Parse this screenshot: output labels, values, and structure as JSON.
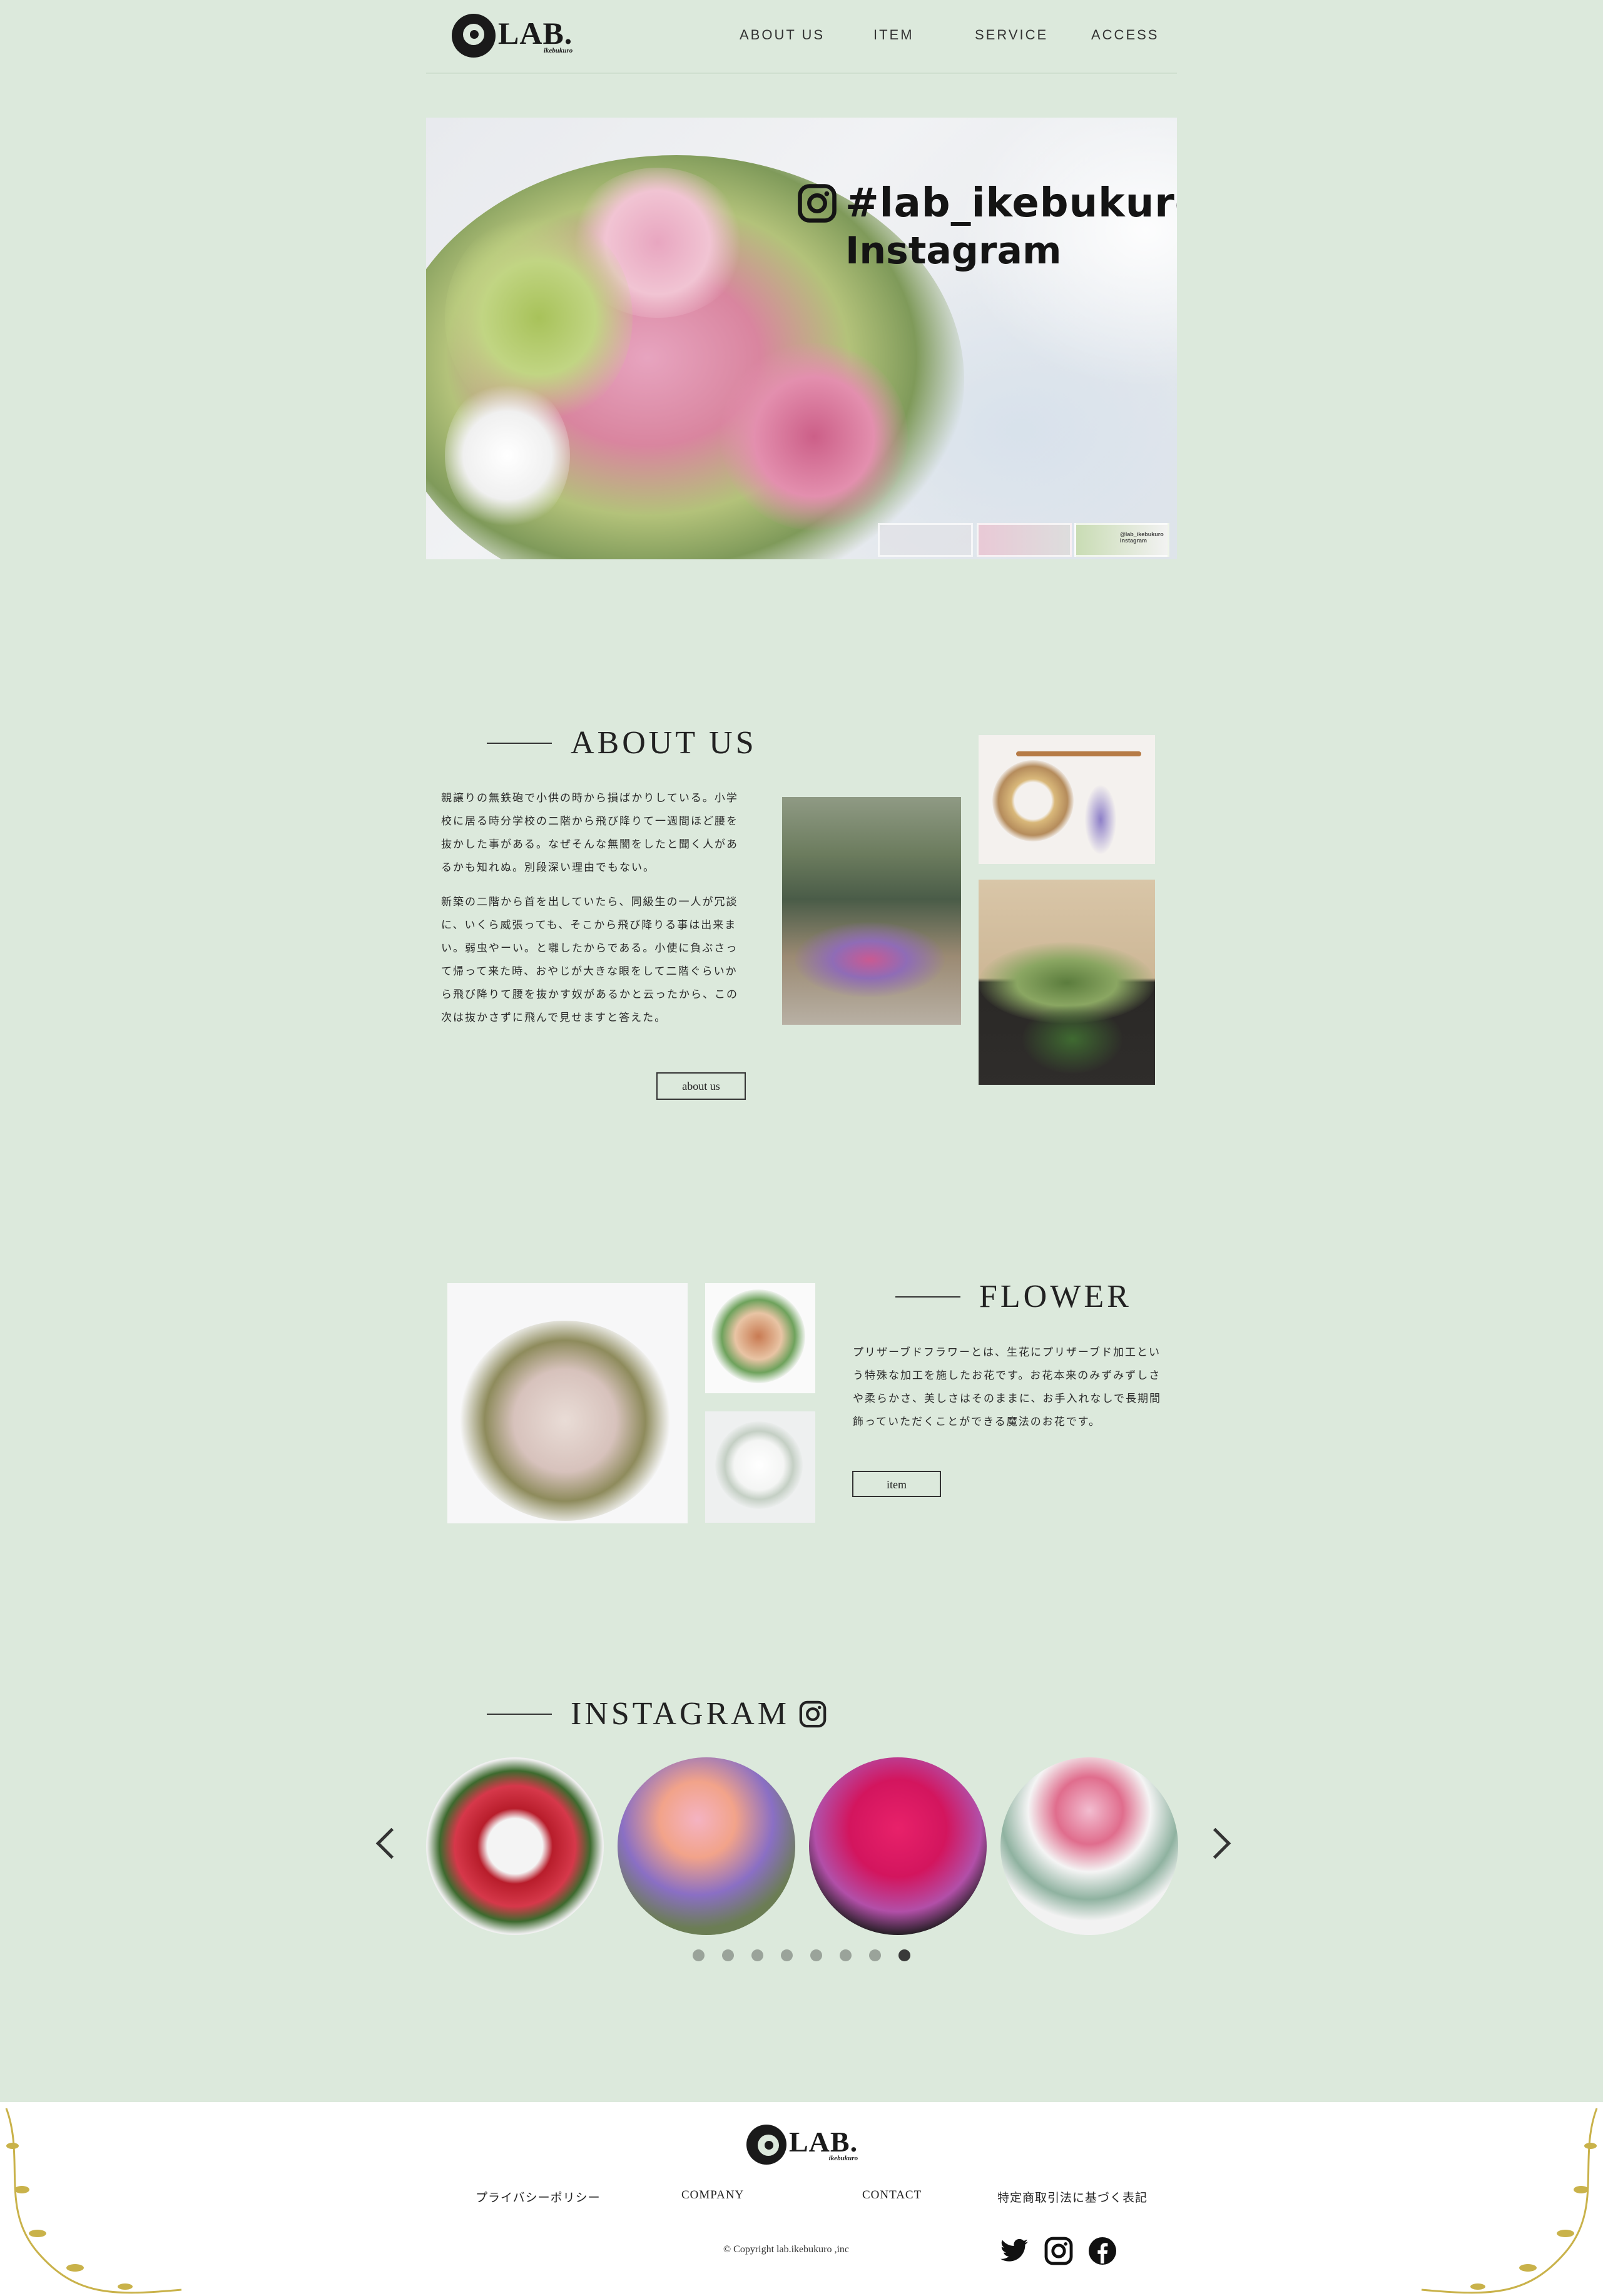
{
  "header": {
    "logo_text": "LAB.",
    "logo_sub": "ikebukuro",
    "nav": [
      "ABOUT US",
      "ITEM",
      "SERVICE",
      "ACCESS"
    ]
  },
  "hero": {
    "hashtag": "#lab_ikebukuro",
    "subtitle": "Instagram",
    "thumb_label": "@lab_ikebukuro Instagram"
  },
  "about": {
    "heading": "ABOUT US",
    "paragraphs": [
      "親譲りの無鉄砲で小供の時から損ばかりしている。小学校に居る時分学校の二階から飛び降りて一週間ほど腰を抜かした事がある。なぜそんな無闇をしたと聞く人があるかも知れぬ。別段深い理由でもない。",
      "新築の二階から首を出していたら、同級生の一人が冗談に、いくら威張っても、そこから飛び降りる事は出来まい。弱虫やーい。と囃したからである。小使に負ぶさって帰って来た時、おやじが大きな眼をして二階ぐらいから飛び降りて腰を抜かす奴があるかと云ったから、この次は抜かさずに飛んで見せますと答えた。"
    ],
    "button": "about us"
  },
  "flower": {
    "heading": "FLOWER",
    "paragraph": "プリザーブドフラワーとは、生花にプリザーブド加工という特殊な加工を施したお花です。お花本来のみずみずしさや柔らかさ、美しさはそのままに、お手入れなしで長期間飾っていただくことができる魔法のお花です。",
    "button": "item"
  },
  "instagram": {
    "heading": "INSTAGRAM",
    "dots": 8,
    "active_dot": 7
  },
  "footer": {
    "logo_text": "LAB.",
    "logo_sub": "ikebukuro",
    "links": [
      "プライバシーポリシー",
      "COMPANY",
      "CONTACT",
      "特定商取引法に基づく表記"
    ],
    "copyright": "© Copyright lab.ikebukuro ,inc",
    "social_icons": [
      "twitter-icon",
      "instagram-icon",
      "facebook-icon"
    ]
  },
  "colors": {
    "page_bg": "#dce9dc",
    "footer_bg": "#ffffff",
    "text": "#1e1e1e",
    "accent_gold": "#c9b24a"
  }
}
